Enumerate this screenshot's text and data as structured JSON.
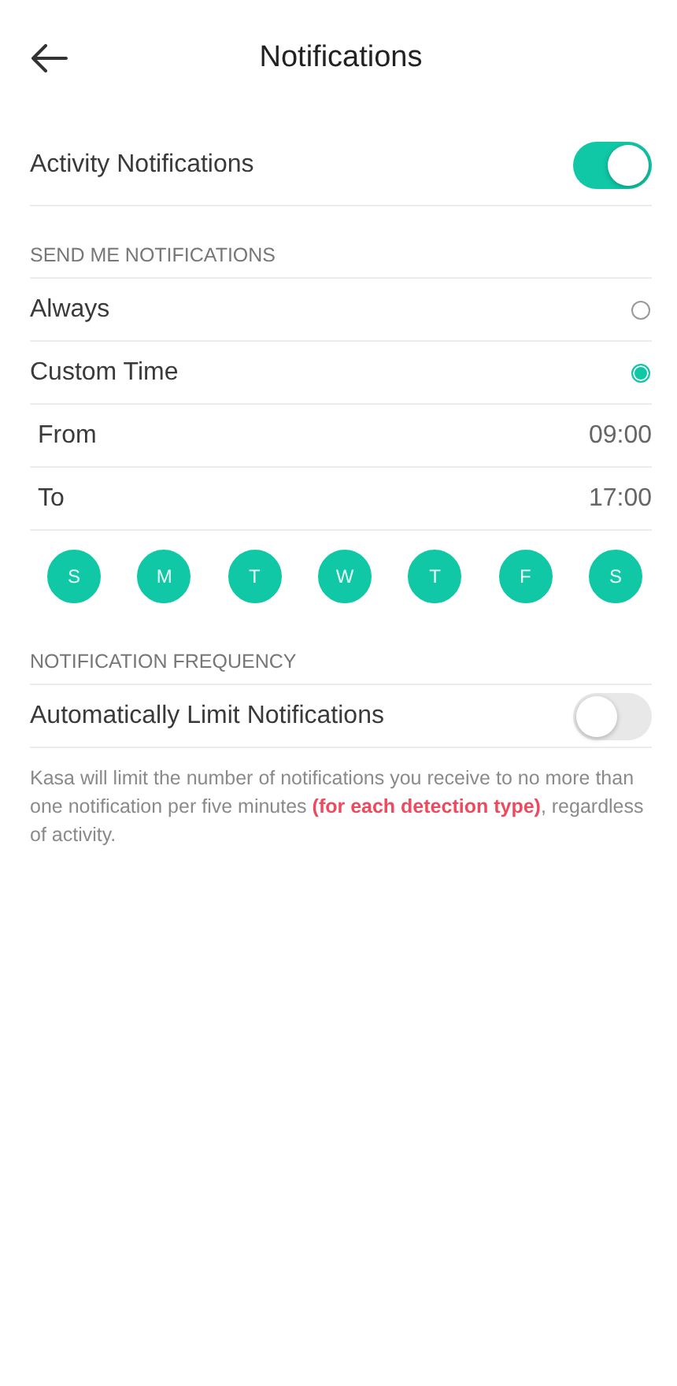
{
  "header": {
    "title": "Notifications"
  },
  "activity": {
    "label": "Activity Notifications",
    "on": true
  },
  "send_section": {
    "heading": "SEND ME NOTIFICATIONS",
    "options": [
      {
        "label": "Always",
        "selected": false
      },
      {
        "label": "Custom Time",
        "selected": true
      }
    ],
    "times": [
      {
        "label": "From",
        "value": "09:00"
      },
      {
        "label": "To",
        "value": "17:00"
      }
    ],
    "days": [
      {
        "label": "S",
        "selected": true
      },
      {
        "label": "M",
        "selected": true
      },
      {
        "label": "T",
        "selected": true
      },
      {
        "label": "W",
        "selected": true
      },
      {
        "label": "T",
        "selected": true
      },
      {
        "label": "F",
        "selected": true
      },
      {
        "label": "S",
        "selected": true
      }
    ]
  },
  "frequency_section": {
    "heading": "NOTIFICATION FREQUENCY",
    "limit": {
      "label": "Automatically Limit Notifications",
      "on": false
    },
    "note": [
      {
        "kind": "plain",
        "text": "Kasa will limit the number of notifications you receive to no more than one notification per five minutes "
      },
      {
        "kind": "highlight",
        "text": "(for each detection type)"
      },
      {
        "kind": "plain",
        "text": ", regardless of activity."
      }
    ]
  }
}
